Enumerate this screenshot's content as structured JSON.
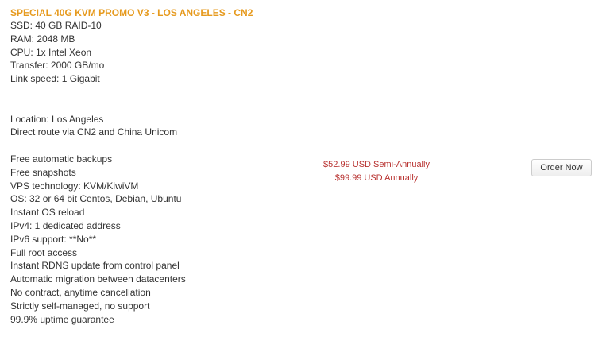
{
  "product": {
    "title": "SPECIAL 40G KVM PROMO V3 - LOS ANGELES - CN2",
    "features": [
      "SSD: 40 GB RAID-10",
      "RAM: 2048 MB",
      "CPU: 1x Intel Xeon",
      "Transfer: 2000 GB/mo",
      "Link speed: 1 Gigabit",
      "",
      "",
      "Location: Los Angeles",
      "Direct route via CN2 and China Unicom",
      "",
      "Free automatic backups",
      "Free snapshots",
      "VPS technology: KVM/KiwiVM",
      "OS: 32 or 64 bit Centos, Debian, Ubuntu",
      "Instant OS reload",
      "IPv4: 1 dedicated address",
      "IPv6 support: **No**",
      "Full root access",
      "Instant RDNS update from control panel",
      "Automatic migration between datacenters",
      "No contract, anytime cancellation",
      "Strictly self-managed, no support",
      "99.9% uptime guarantee"
    ],
    "pricing": [
      "$52.99 USD Semi-Annually",
      "$99.99 USD Annually"
    ],
    "order_label": "Order Now"
  },
  "colors": {
    "title": "#e69a1e",
    "price": "#b8312f",
    "text": "#333333"
  }
}
